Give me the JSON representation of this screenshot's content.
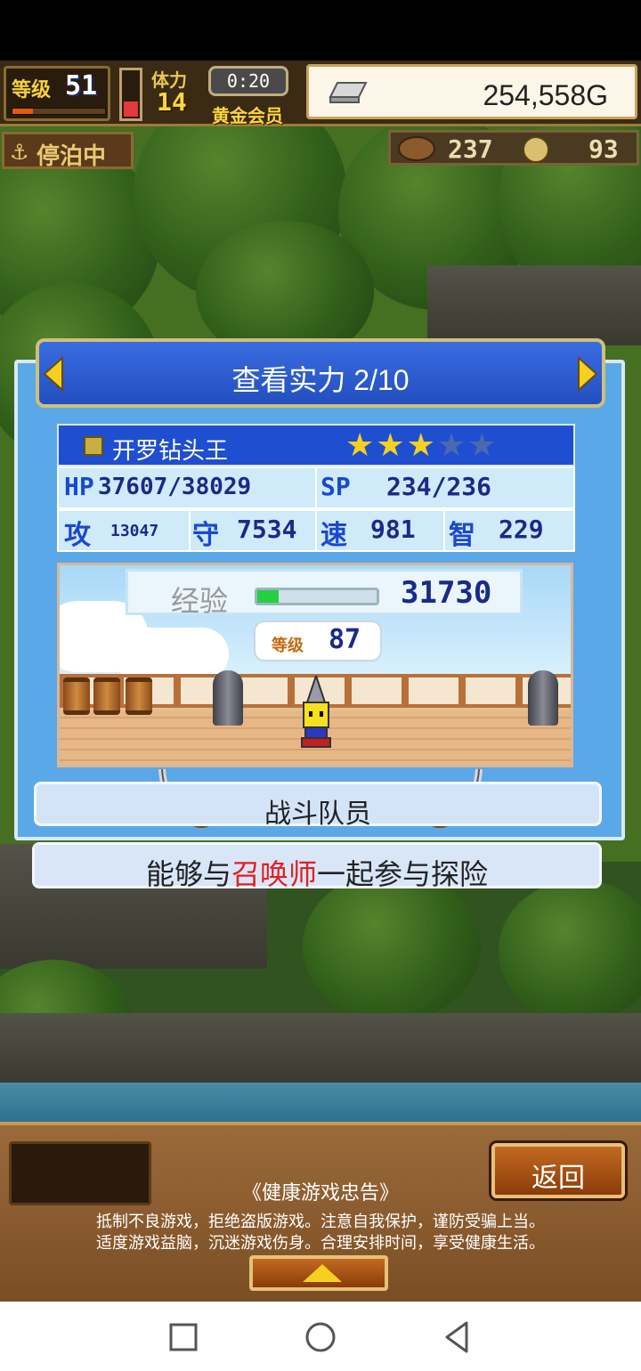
{
  "hud": {
    "level_label": "等级",
    "level": "51",
    "level_progress": 0.22,
    "stamina_fill": 0.3,
    "stamina_label": "体力",
    "stamina": "14",
    "timer": "0:20",
    "membership": "黄金会员",
    "gold": "254,558G",
    "status": "停泊中",
    "resource1": "237",
    "resource2": "93"
  },
  "dialog": {
    "title": "查看实力 2/10",
    "character_name": "开罗钻头王",
    "stars_filled": 3,
    "stars_total": 5,
    "stats": {
      "hp_label": "HP",
      "hp": "37607/38029",
      "sp_label": "SP",
      "sp": "234/236",
      "atk_label": "攻",
      "atk": "13047",
      "def_label": "守",
      "def": "7534",
      "spd_label": "速",
      "spd": "981",
      "int_label": "智",
      "int": "229"
    },
    "exp_label": "经验",
    "exp_progress": 0.18,
    "exp": "31730",
    "char_level_label": "等级",
    "char_level": "87",
    "role": "战斗队员",
    "description_pre": "能够与",
    "description_highlight": "召唤师",
    "description_post": "一起参与探险"
  },
  "bottom": {
    "back_label": "返回",
    "health_title": "《健康游戏忠告》",
    "health_line1": "抵制不良游戏，拒绝盗版游戏。注意自我保护，谨防受骗上当。",
    "health_line2": "适度游戏益脑，沉迷游戏伤身。合理安排时间，享受健康生活。"
  },
  "colors": {
    "accent_blue": "#234fc0",
    "highlight_red": "#e02020",
    "star_gold": "#f6d020"
  }
}
